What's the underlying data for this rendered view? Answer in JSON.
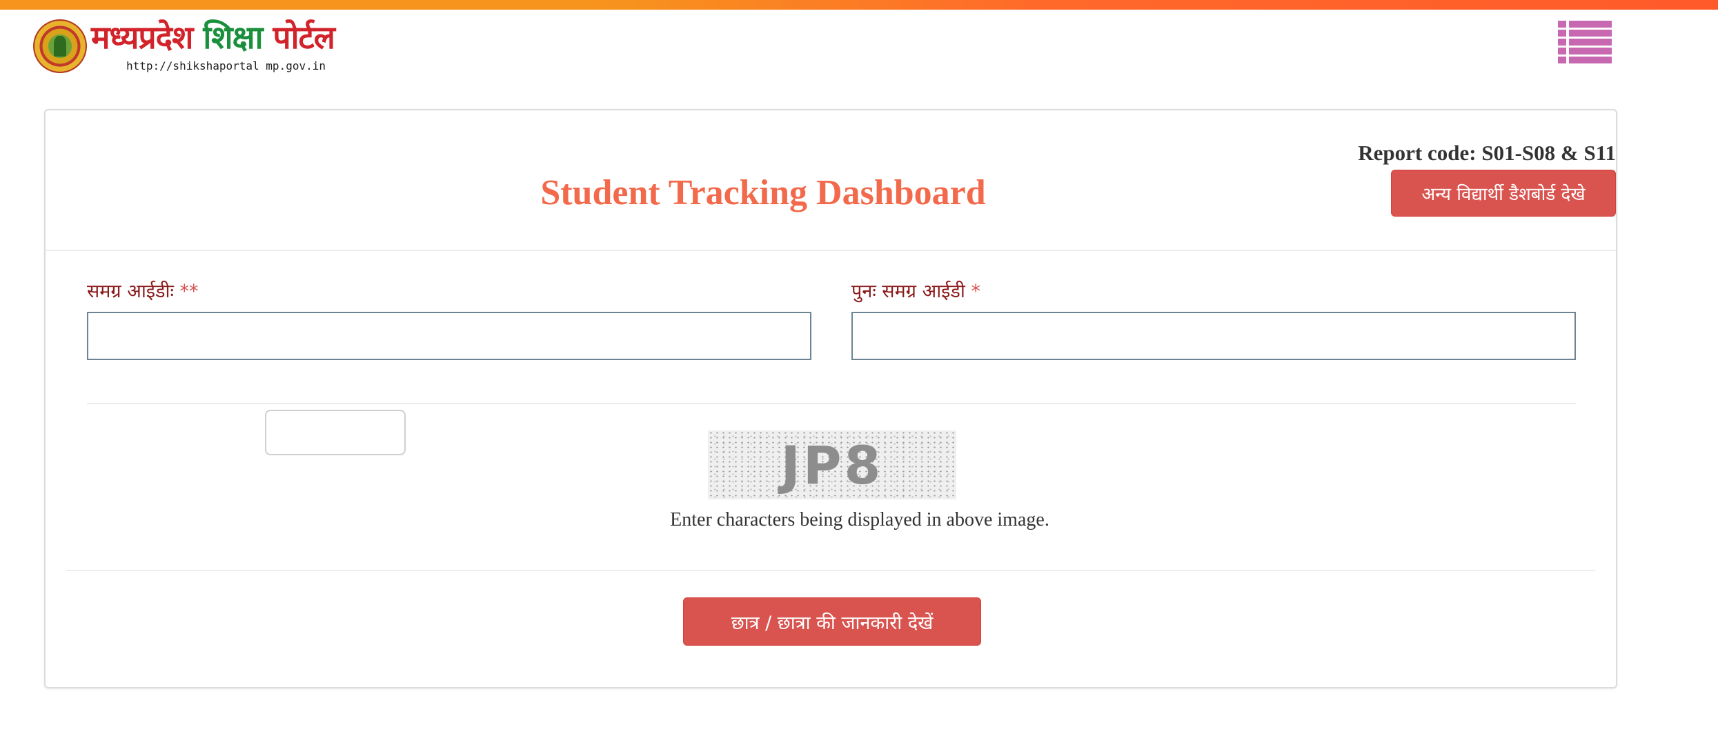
{
  "header": {
    "logo_title_red": "मध्यप्रदेश",
    "logo_title_green": "शिक्षा",
    "logo_title_red2": "पोर्टल",
    "logo_url": "http://shikshaportal mp.gov.in",
    "menu_icon": "list-menu-icon",
    "colors": {
      "topbar_start": "#f7941d",
      "topbar_end": "#ff5a2a",
      "menu": "#c768b0"
    }
  },
  "panel": {
    "report_code": "Report code: S01-S08 & S11",
    "other_dashboard_button": "अन्य विद्यार्थी डैशबोर्ड देखे",
    "title": "Student Tracking Dashboard",
    "colors": {
      "title": "#f26a4b",
      "button": "#d9534f",
      "label": "#8b1a1a"
    }
  },
  "form": {
    "samagra_id_label": "समग्र आईडीः",
    "samagra_id_required": "**",
    "samagra_id_value": "",
    "confirm_samagra_id_label": "पुनः समग्र आईडी",
    "confirm_samagra_id_required": "*",
    "confirm_samagra_id_value": "",
    "captcha_value": "",
    "captcha_text": "JP8",
    "captcha_hint": "Enter characters being displayed in above image.",
    "submit_button": "छात्र / छात्रा की जानकारी देखें"
  }
}
